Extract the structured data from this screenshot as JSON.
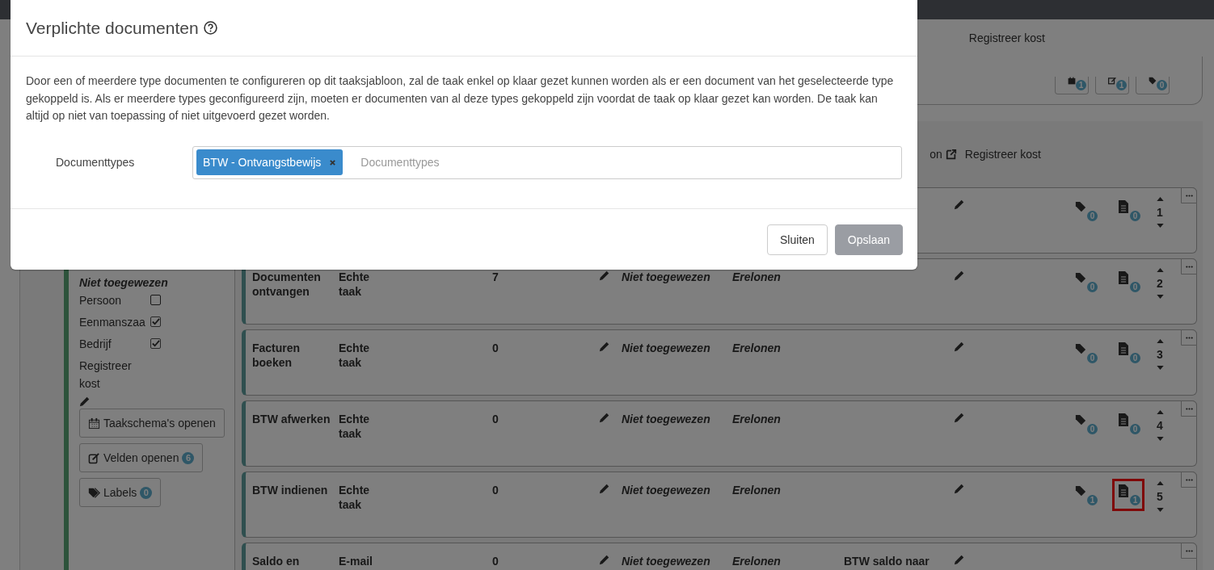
{
  "header": {
    "link": "Registreer kost",
    "counters": [
      {
        "badge": "1"
      },
      {
        "badge": "1"
      },
      {
        "badge": "0"
      }
    ]
  },
  "section_links": [
    {
      "text": "on",
      "kind": "external"
    },
    {
      "text": "Registreer kost",
      "kind": "plain"
    }
  ],
  "left_panel": {
    "assignee": "Niet toegewezen",
    "checks": [
      {
        "label": "Persoon",
        "checked": false
      },
      {
        "label": "Eenmanszaa",
        "checked": true
      },
      {
        "label": "Bedrijf",
        "checked": true
      }
    ],
    "cost_label": "Registreer kost",
    "buttons": [
      {
        "label": "Taakschema's openen"
      },
      {
        "label": "Velden openen",
        "badge": "6"
      },
      {
        "label": "Labels",
        "badge": "0"
      }
    ]
  },
  "tasks": [
    {
      "labels": "0",
      "documents": "0",
      "order": "1",
      "highlighted": false
    },
    {
      "name": "Documenten ontvangen",
      "type": "Echte taak",
      "count": "7",
      "assignee": "Niet toegewezen",
      "category": "Erelonen",
      "labels": "0",
      "documents": "0",
      "order": "2",
      "highlighted": false
    },
    {
      "name": "Facturen boeken",
      "type": "Echte taak",
      "count": "0",
      "assignee": "Niet toegewezen",
      "category": "Erelonen",
      "labels": "0",
      "documents": "0",
      "order": "3",
      "highlighted": false
    },
    {
      "name": "BTW afwerken",
      "type": "Echte taak",
      "count": "0",
      "assignee": "Niet toegewezen",
      "category": "Erelonen",
      "labels": "0",
      "documents": "0",
      "order": "4",
      "highlighted": false
    },
    {
      "name": "BTW indienen",
      "type": "Echte taak",
      "count": "0",
      "assignee": "Niet toegewezen",
      "category": "Erelonen",
      "labels": "1",
      "documents": "1",
      "order": "5",
      "highlighted": true
    },
    {
      "name": "Saldo en",
      "type": "E-mail",
      "count": "0",
      "assignee": "Niet toegewezen",
      "category": "Erelonen",
      "note": "BTW saldo naar"
    }
  ],
  "modal": {
    "title": "Verplichte documenten",
    "description": "Door een of meerdere type documenten te configureren op dit taaksjabloon, zal de taak enkel op klaar gezet kunnen worden als er een document van het geselecteerde type gekoppeld is. Als er meerdere types geconfigureerd zijn, moeten er documenten van al deze types gekoppeld zijn voordat de taak op klaar gezet kan worden. De taak kan altijd op niet van toepassing of niet uitgevoerd gezet worden.",
    "field_label": "Documenttypes",
    "tags": [
      "BTW - Ontvangstbewijs"
    ],
    "placeholder": "Documenttypes",
    "buttons": [
      {
        "label": "Sluiten",
        "kind": "secondary"
      },
      {
        "label": "Opslaan",
        "kind": "primary"
      }
    ]
  }
}
